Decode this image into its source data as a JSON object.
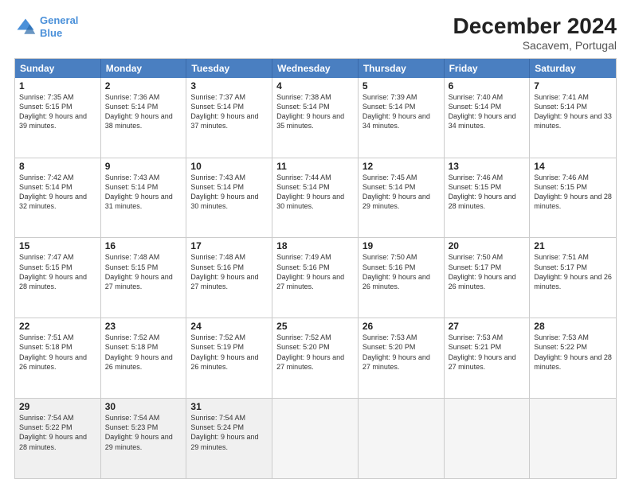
{
  "header": {
    "logo_line1": "General",
    "logo_line2": "Blue",
    "month": "December 2024",
    "location": "Sacavem, Portugal"
  },
  "weekdays": [
    "Sunday",
    "Monday",
    "Tuesday",
    "Wednesday",
    "Thursday",
    "Friday",
    "Saturday"
  ],
  "weeks": [
    [
      {
        "day": "1",
        "rise": "7:35 AM",
        "set": "5:15 PM",
        "daylight": "9 hours and 39 minutes."
      },
      {
        "day": "2",
        "rise": "7:36 AM",
        "set": "5:14 PM",
        "daylight": "9 hours and 38 minutes."
      },
      {
        "day": "3",
        "rise": "7:37 AM",
        "set": "5:14 PM",
        "daylight": "9 hours and 37 minutes."
      },
      {
        "day": "4",
        "rise": "7:38 AM",
        "set": "5:14 PM",
        "daylight": "9 hours and 35 minutes."
      },
      {
        "day": "5",
        "rise": "7:39 AM",
        "set": "5:14 PM",
        "daylight": "9 hours and 34 minutes."
      },
      {
        "day": "6",
        "rise": "7:40 AM",
        "set": "5:14 PM",
        "daylight": "9 hours and 34 minutes."
      },
      {
        "day": "7",
        "rise": "7:41 AM",
        "set": "5:14 PM",
        "daylight": "9 hours and 33 minutes."
      }
    ],
    [
      {
        "day": "8",
        "rise": "7:42 AM",
        "set": "5:14 PM",
        "daylight": "9 hours and 32 minutes."
      },
      {
        "day": "9",
        "rise": "7:43 AM",
        "set": "5:14 PM",
        "daylight": "9 hours and 31 minutes."
      },
      {
        "day": "10",
        "rise": "7:43 AM",
        "set": "5:14 PM",
        "daylight": "9 hours and 30 minutes."
      },
      {
        "day": "11",
        "rise": "7:44 AM",
        "set": "5:14 PM",
        "daylight": "9 hours and 30 minutes."
      },
      {
        "day": "12",
        "rise": "7:45 AM",
        "set": "5:14 PM",
        "daylight": "9 hours and 29 minutes."
      },
      {
        "day": "13",
        "rise": "7:46 AM",
        "set": "5:15 PM",
        "daylight": "9 hours and 28 minutes."
      },
      {
        "day": "14",
        "rise": "7:46 AM",
        "set": "5:15 PM",
        "daylight": "9 hours and 28 minutes."
      }
    ],
    [
      {
        "day": "15",
        "rise": "7:47 AM",
        "set": "5:15 PM",
        "daylight": "9 hours and 28 minutes."
      },
      {
        "day": "16",
        "rise": "7:48 AM",
        "set": "5:15 PM",
        "daylight": "9 hours and 27 minutes."
      },
      {
        "day": "17",
        "rise": "7:48 AM",
        "set": "5:16 PM",
        "daylight": "9 hours and 27 minutes."
      },
      {
        "day": "18",
        "rise": "7:49 AM",
        "set": "5:16 PM",
        "daylight": "9 hours and 27 minutes."
      },
      {
        "day": "19",
        "rise": "7:50 AM",
        "set": "5:16 PM",
        "daylight": "9 hours and 26 minutes."
      },
      {
        "day": "20",
        "rise": "7:50 AM",
        "set": "5:17 PM",
        "daylight": "9 hours and 26 minutes."
      },
      {
        "day": "21",
        "rise": "7:51 AM",
        "set": "5:17 PM",
        "daylight": "9 hours and 26 minutes."
      }
    ],
    [
      {
        "day": "22",
        "rise": "7:51 AM",
        "set": "5:18 PM",
        "daylight": "9 hours and 26 minutes."
      },
      {
        "day": "23",
        "rise": "7:52 AM",
        "set": "5:18 PM",
        "daylight": "9 hours and 26 minutes."
      },
      {
        "day": "24",
        "rise": "7:52 AM",
        "set": "5:19 PM",
        "daylight": "9 hours and 26 minutes."
      },
      {
        "day": "25",
        "rise": "7:52 AM",
        "set": "5:20 PM",
        "daylight": "9 hours and 27 minutes."
      },
      {
        "day": "26",
        "rise": "7:53 AM",
        "set": "5:20 PM",
        "daylight": "9 hours and 27 minutes."
      },
      {
        "day": "27",
        "rise": "7:53 AM",
        "set": "5:21 PM",
        "daylight": "9 hours and 27 minutes."
      },
      {
        "day": "28",
        "rise": "7:53 AM",
        "set": "5:22 PM",
        "daylight": "9 hours and 28 minutes."
      }
    ],
    [
      {
        "day": "29",
        "rise": "7:54 AM",
        "set": "5:22 PM",
        "daylight": "9 hours and 28 minutes."
      },
      {
        "day": "30",
        "rise": "7:54 AM",
        "set": "5:23 PM",
        "daylight": "9 hours and 29 minutes."
      },
      {
        "day": "31",
        "rise": "7:54 AM",
        "set": "5:24 PM",
        "daylight": "9 hours and 29 minutes."
      },
      null,
      null,
      null,
      null
    ]
  ]
}
